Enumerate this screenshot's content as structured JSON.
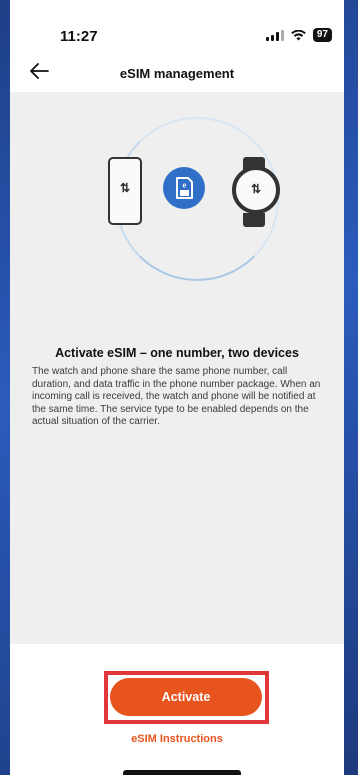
{
  "status_bar": {
    "time": "11:27",
    "battery": "97",
    "signal_icon": "signal-bars-icon",
    "wifi_icon": "wifi-icon"
  },
  "nav": {
    "title": "eSIM management",
    "back_icon": "arrow-left-icon"
  },
  "illustration": {
    "phone_icon": "phone-icon",
    "esim_icon": "esim-chip-icon",
    "watch_icon": "watch-icon",
    "transfer_glyph": "⇅"
  },
  "main": {
    "headline": "Activate eSIM – one number, two devices",
    "description": "The watch and phone share the same phone number, call duration, and data traffic in the phone number package. When an incoming call is received, the watch and phone will be notified at the same time. The service type to be enabled depends on the actual situation of the carrier."
  },
  "actions": {
    "activate_label": "Activate",
    "instructions_label": "eSIM Instructions"
  },
  "colors": {
    "accent": "#e8541e",
    "esim_blue": "#2f6fc7",
    "highlight_border": "#e2373a",
    "content_bg": "#efefef"
  }
}
